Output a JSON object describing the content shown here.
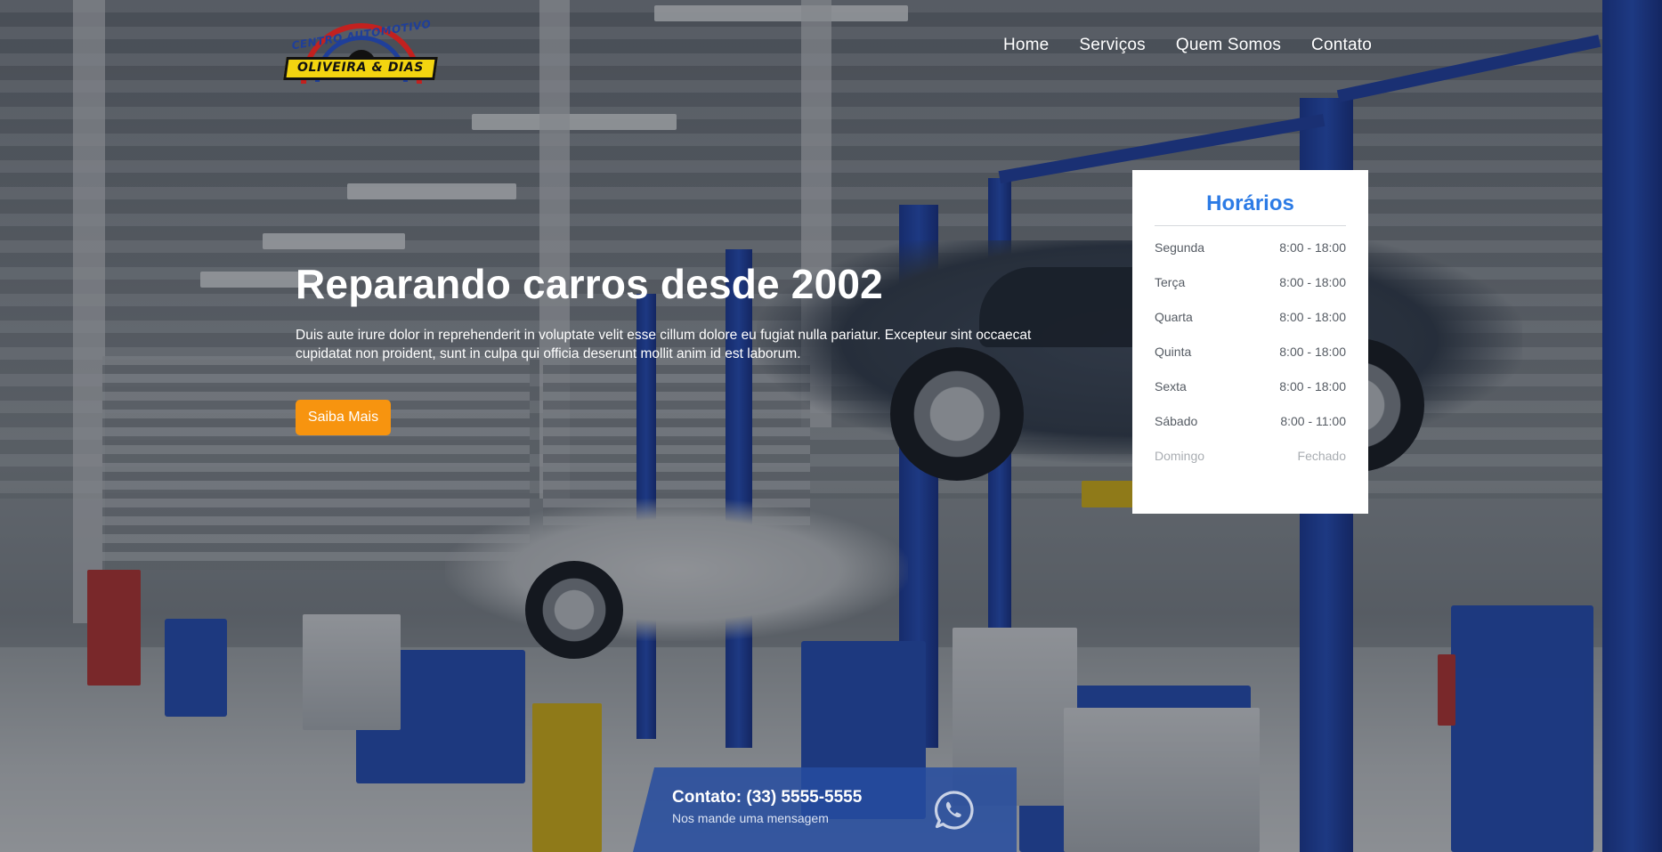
{
  "logo": {
    "top_text": "CENTRO AUTOMOTIVO",
    "name": "OLIVEIRA & DIAS"
  },
  "nav": {
    "items": [
      {
        "label": "Home"
      },
      {
        "label": "Serviços"
      },
      {
        "label": "Quem Somos"
      },
      {
        "label": "Contato"
      }
    ]
  },
  "hero": {
    "title": "Reparando carros desde 2002",
    "text": "Duis aute irure dolor in reprehenderit in voluptate velit esse cillum dolore eu fugiat nulla pariatur. Excepteur sint occaecat cupidatat non proident, sunt in culpa qui officia deserunt mollit anim id est laborum.",
    "button_label": "Saiba Mais"
  },
  "hours": {
    "title": "Horários",
    "rows": [
      {
        "day": "Segunda",
        "time": "8:00 - 18:00"
      },
      {
        "day": "Terça",
        "time": "8:00 - 18:00"
      },
      {
        "day": "Quarta",
        "time": "8:00 - 18:00"
      },
      {
        "day": "Quinta",
        "time": "8:00 - 18:00"
      },
      {
        "day": "Sexta",
        "time": "8:00 - 18:00"
      },
      {
        "day": "Sábado",
        "time": "8:00 - 11:00"
      },
      {
        "day": "Domingo",
        "time": "Fechado"
      }
    ]
  },
  "contact": {
    "title": "Contato: (33) 5555-5555",
    "subtitle": "Nos mande uma mensagem",
    "icon": "whatsapp-icon"
  },
  "colors": {
    "accent_orange": "#f7940f",
    "hours_title_blue": "#2c7be5",
    "contact_blue": "#264ca0"
  }
}
